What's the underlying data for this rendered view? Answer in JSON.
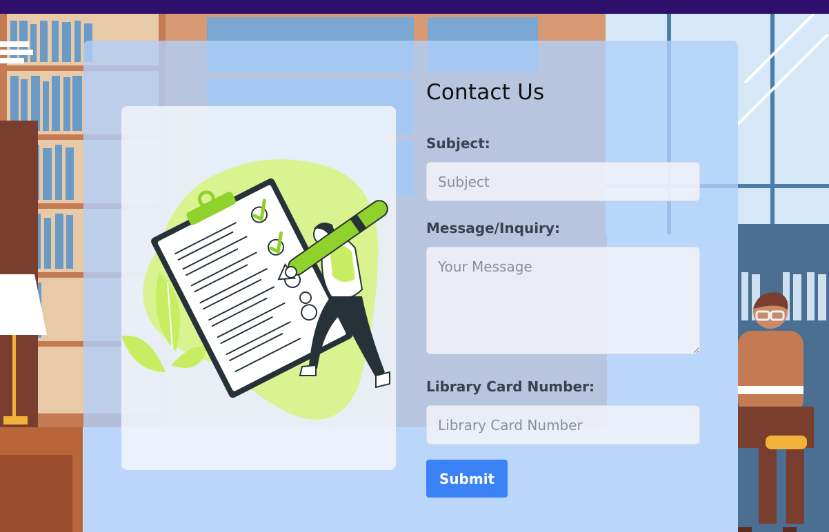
{
  "form": {
    "title": "Contact Us",
    "subject_label": "Subject:",
    "subject_placeholder": "Subject",
    "message_label": "Message/Inquiry:",
    "message_placeholder": "Your Message",
    "card_label": "Library Card Number:",
    "card_placeholder": "Library Card Number",
    "submit_label": "Submit"
  },
  "colors": {
    "topbar": "#2e0f6b",
    "card_overlay": "#b0d0fa",
    "submit_button": "#3b82f6",
    "label_text": "#374151"
  },
  "icons": {
    "illustration": "checklist-illustration",
    "background": "library-background-illustration"
  }
}
